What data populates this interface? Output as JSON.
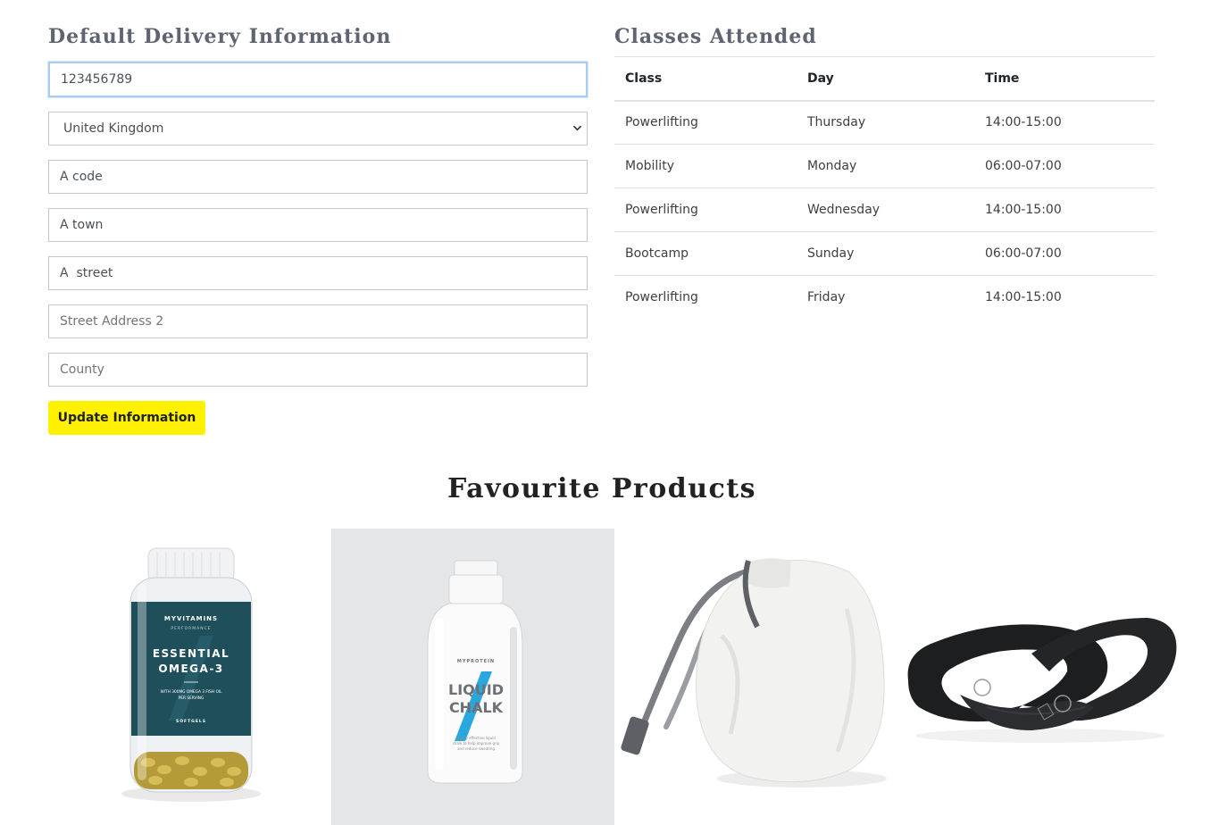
{
  "delivery": {
    "title": "Default Delivery Information",
    "phone_value": "123456789",
    "country_selected": "United Kingdom",
    "postcode_value": "A code",
    "town_value": "A town",
    "street1_value": "A  street",
    "street2_placeholder": "Street Address 2",
    "county_placeholder": "County",
    "update_button_label": "Update Information"
  },
  "classes": {
    "title": "Classes Attended",
    "headers": {
      "class": "Class",
      "day": "Day",
      "time": "Time"
    },
    "rows": [
      {
        "class": "Powerlifting",
        "day": "Thursday",
        "time": "14:00-15:00"
      },
      {
        "class": "Mobility",
        "day": "Monday",
        "time": "06:00-07:00"
      },
      {
        "class": "Powerlifting",
        "day": "Wednesday",
        "time": "14:00-15:00"
      },
      {
        "class": "Bootcamp",
        "day": "Sunday",
        "time": "06:00-07:00"
      },
      {
        "class": "Powerlifting",
        "day": "Friday",
        "time": "14:00-15:00"
      }
    ]
  },
  "favourites": {
    "title": "Favourite Products",
    "products": [
      {
        "name": "omega-3-bottle",
        "label_lines": [
          "MYVITAMINS",
          "PERFORMANCE",
          "ESSENTIAL",
          "OMEGA-3",
          "WITH 300MG OMEGA 3 FISH OIL",
          "PER SERVING",
          "SOFTGELS"
        ],
        "label_color": "#1f4f5a"
      },
      {
        "name": "liquid-chalk-bottle",
        "label_lines": [
          "MYPROTEIN",
          "LIQUID",
          "CHALK",
          "Highly effective liquid",
          "chalk to help improve grip",
          "and reduce sweating"
        ],
        "accent_color": "#29a8e0"
      },
      {
        "name": "chalk-ball",
        "label_lines": []
      },
      {
        "name": "lifting-straps",
        "label_lines": []
      }
    ]
  }
}
